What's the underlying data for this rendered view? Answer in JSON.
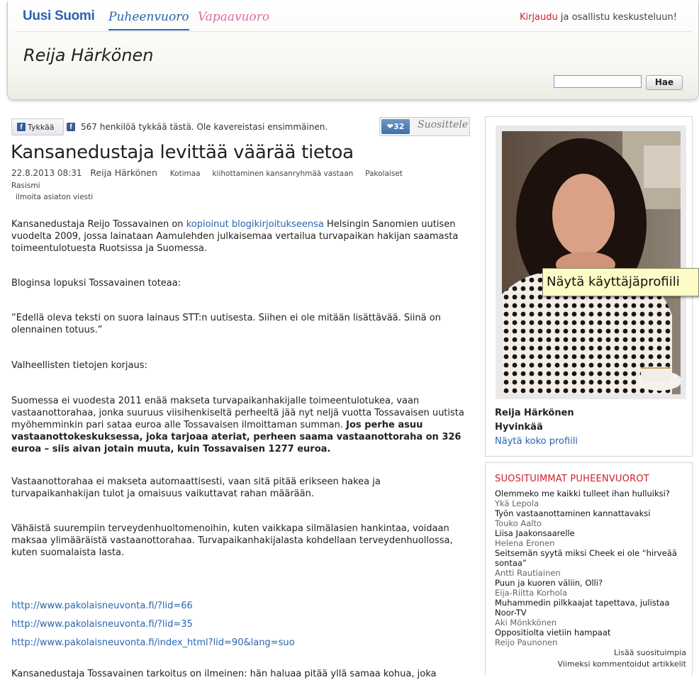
{
  "header": {
    "logo": "Uusi Suomi",
    "tab_puheenvuoro": "Puheenvuoro",
    "tab_vapaavuoro": "Vapaavuoro",
    "login_link": "Kirjaudu",
    "login_rest": " ja osallistu keskusteluun!",
    "blogger_name": "Reija Härkönen",
    "search_button": "Hae"
  },
  "social": {
    "like_button": "Tykkää",
    "like_text": "567 henkilöä tykkää tästä. Ole kavereistasi ensimmäinen.",
    "recommend_count": "❤32",
    "recommend_label": "Suosittele"
  },
  "article": {
    "title": "Kansanedustaja levittää väärää tietoa",
    "date": "22.8.2013 08:31",
    "author": "Reija Härkönen",
    "tags": [
      "Kotimaa",
      "kiihottaminen kansanryhmää vastaan",
      "Pakolaiset",
      "Rasismi"
    ],
    "report": "ilmoita asiaton viesti",
    "p1_before": "Kansanedustaja Reijo Tossavainen on ",
    "p1_link": "kopioinut blogikirjoitukseensa",
    "p1_after": " Helsingin Sanomien uutisen vuodelta 2009, jossa lainataan Aamulehden julkaisemaa vertailua turvapaikan hakijan saamasta toimeentulotuesta Ruotsissa ja Suomessa.",
    "p2": "Bloginsa lopuksi Tossavainen toteaa:",
    "p3": "”Edellä oleva teksti on suora lainaus STT:n uutisesta. Siihen ei ole mitään lisättävää. Siinä on olennainen totuus.”",
    "p4": "Valheellisten tietojen korjaus:",
    "p5_normal": "Suomessa ei vuodesta 2011 enää makseta turvapaikanhakijalle toimeentulotukea, vaan vastaanottorahaa, jonka suuruus viisihenkiseltä perheeltä jää nyt neljä vuotta Tossavaisen uutista myöhemminkin pari sataa euroa alle Tossavaisen ilmoittaman summan. ",
    "p5_bold": "Jos perhe asuu vastaanottokeskuksessa, joka tarjoaa ateriat, perheen saama vastaanottoraha on 326 euroa – siis aivan jotain muuta, kuin Tossavaisen 1277 euroa.",
    "p6": "Vastaanottorahaa ei makseta automaattisesti, vaan sitä pitää erikseen hakea ja turvapaikanhakijan tulot ja omaisuus vaikuttavat rahan määrään.",
    "p7": "Vähäistä suurempiin terveydenhuoltomenoihin, kuten vaikkapa silmälasien hankintaa, voidaan maksaa ylimääräistä vastaanottorahaa. Turvapaikanhakijalasta kohdellaan terveydenhuollossa, kuten suomalaista lasta.",
    "urls": [
      "http://www.pakolaisneuvonta.fi/?lid=66",
      "http://www.pakolaisneuvonta.fi/?lid=35",
      "http://www.pakolaisneuvonta.fi/index_html?lid=90&lang=suo"
    ],
    "p8_partial": "Kansanedustaja Tossavainen tarkoitus on ilmeinen: hän haluaa pitää yllä samaa kohua, joka"
  },
  "profile": {
    "tooltip": "Näytä käyttäjäprofiili",
    "name": "Reija Härkönen",
    "city": "Hyvinkää",
    "link": "Näytä koko profiili"
  },
  "popular": {
    "title": "SUOSITUIMMAT PUHEENVUOROT",
    "items": [
      {
        "title": "Olemmeko me kaikki tulleet ihan hulluiksi?",
        "author": "Ykä Lepola"
      },
      {
        "title": "Työn vastaanottaminen kannattavaksi",
        "author": "Touko Aalto"
      },
      {
        "title": "Liisa Jaakonsaarelle",
        "author": "Helena Eronen"
      },
      {
        "title": "Seitsemän syytä miksi Cheek ei ole “hirveää sontaa”",
        "author": "Antti Rautiainen"
      },
      {
        "title": "Puun ja kuoren väliin, Olli?",
        "author": "Eija-Riitta Korhola"
      },
      {
        "title": "Muhammedin pilkkaajat tapettava, julistaa Noor-TV",
        "author": "Aki Mönkkönen"
      },
      {
        "title": "Oppositiolta vietiin hampaat",
        "author": "Reijo Paunonen"
      }
    ],
    "more_popular": "Lisää suosituimpia",
    "latest_commented": "Viimeksi kommentoidut artikkelit"
  }
}
